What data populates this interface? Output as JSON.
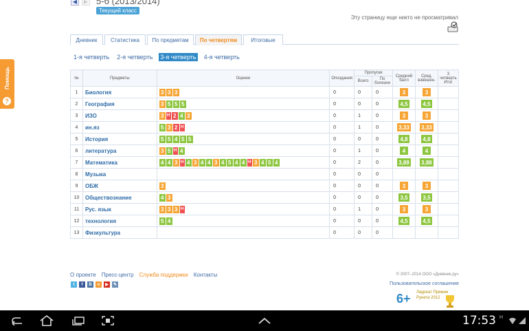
{
  "header": {
    "class_title": "5-б (2013/2014)",
    "current_class_badge": "Текущий класс",
    "no_views_text": "Эту страницу еще никто не просматривал"
  },
  "help_tab": {
    "label": "Помощь",
    "icon": "question-icon"
  },
  "tabs": [
    {
      "label": "Дневник",
      "active": false,
      "w": 48
    },
    {
      "label": "Статистика",
      "active": false,
      "w": 60
    },
    {
      "label": "По предметам",
      "active": false,
      "w": 68
    },
    {
      "label": "По четвертям",
      "active": true,
      "w": 68
    },
    {
      "label": "Итоговые",
      "active": false,
      "w": 58
    }
  ],
  "quarters": [
    {
      "label": "1-я четверть",
      "active": false
    },
    {
      "label": "2-я четверть",
      "active": false
    },
    {
      "label": "3-я четверть",
      "active": true
    },
    {
      "label": "4-я четверть",
      "active": false
    }
  ],
  "table": {
    "headers": {
      "num": "№",
      "subjects": "Предметы",
      "marks": "Оценки",
      "late": "Опоздания",
      "absences": "Пропуски",
      "total": "Всего",
      "sick": "По болезни",
      "avg": "Средний балл",
      "weighted": "Сред. взвешен.",
      "final": "3 четверть Итог"
    },
    "rows": [
      {
        "n": "1",
        "subject": "Биология",
        "marks": [
          "3",
          "3",
          "3"
        ],
        "late": "0",
        "total": "0",
        "sick": "0",
        "avg": "3",
        "weighted": "3",
        "avg_color": "orange"
      },
      {
        "n": "2",
        "subject": "География",
        "marks": [
          "3",
          "5",
          "5",
          "5"
        ],
        "late": "0",
        "total": "0",
        "sick": "0",
        "avg": "4,5",
        "weighted": "4,5",
        "avg_color": "green"
      },
      {
        "n": "3",
        "subject": "ИЗО",
        "marks": [
          "3",
          "Н",
          "2",
          "4",
          "3"
        ],
        "late": "0",
        "total": "1",
        "sick": "0",
        "avg": "3",
        "weighted": "3",
        "avg_color": "orange"
      },
      {
        "n": "4",
        "subject": "ин.яз",
        "marks": [
          "5",
          "3",
          "2",
          "Н"
        ],
        "late": "0",
        "total": "1",
        "sick": "0",
        "avg": "3,33",
        "weighted": "3,33",
        "avg_color": "orange"
      },
      {
        "n": "5",
        "subject": "История",
        "marks": [
          "5",
          "5",
          "4",
          "5",
          "5"
        ],
        "late": "0",
        "total": "0",
        "sick": "0",
        "avg": "4,8",
        "weighted": "4,8",
        "avg_color": "green"
      },
      {
        "n": "6",
        "subject": "литература",
        "marks": [
          "3",
          "5",
          "Н",
          "4"
        ],
        "late": "0",
        "total": "1",
        "sick": "0",
        "avg": "4",
        "weighted": "4",
        "avg_color": "green"
      },
      {
        "n": "7",
        "subject": "Математика",
        "marks": [
          "4",
          "4",
          "3",
          "Н",
          "4",
          "3",
          "4",
          "4",
          "3",
          "4",
          "5",
          "4",
          "4",
          "Н",
          "3",
          "4",
          "5",
          "4"
        ],
        "late": "0",
        "total": "2",
        "sick": "0",
        "avg": "3,88",
        "weighted": "3,88",
        "avg_color": "green"
      },
      {
        "n": "8",
        "subject": "Музыка",
        "marks": [],
        "late": "0",
        "total": "0",
        "sick": "0",
        "avg": "",
        "weighted": "",
        "avg_color": ""
      },
      {
        "n": "9",
        "subject": "ОБЖ",
        "marks": [
          "3"
        ],
        "late": "0",
        "total": "0",
        "sick": "0",
        "avg": "3",
        "weighted": "3",
        "avg_color": "orange"
      },
      {
        "n": "10",
        "subject": "Обществознание",
        "marks": [
          "4",
          "3"
        ],
        "late": "0",
        "total": "0",
        "sick": "0",
        "avg": "3,5",
        "weighted": "3,5",
        "avg_color": "green"
      },
      {
        "n": "11",
        "subject": "Рус. язык",
        "marks": [
          "3",
          "3",
          "3",
          "Н"
        ],
        "late": "0",
        "total": "1",
        "sick": "0",
        "avg": "3",
        "weighted": "3",
        "avg_color": "orange"
      },
      {
        "n": "12",
        "subject": "технология",
        "marks": [
          "5",
          "4"
        ],
        "late": "0",
        "total": "0",
        "sick": "0",
        "avg": "4,5",
        "weighted": "4,5",
        "avg_color": "green"
      },
      {
        "n": "13",
        "subject": "Физкультура",
        "marks": [],
        "late": "0",
        "total": "0",
        "sick": "0",
        "avg": "",
        "weighted": "",
        "avg_color": ""
      }
    ]
  },
  "footer": {
    "links": [
      "О проекте",
      "Пресс-центр",
      "Служба поддержки",
      "Контакты"
    ],
    "copyright": "© 2007–2014 ООО «Дневник.ру»",
    "agreement": "Пользовательское соглашение",
    "age_rating": "6+",
    "laureate_line1": "Лауреат Премии",
    "laureate_line2": "Рунета 2012",
    "social": [
      {
        "name": "twitter-icon",
        "glyph": "t",
        "color": "#4fb2e3"
      },
      {
        "name": "facebook-icon",
        "glyph": "f",
        "color": "#3b5998"
      },
      {
        "name": "vkontakte-icon",
        "glyph": "B",
        "color": "#4c75a3"
      },
      {
        "name": "odnoklassniki-icon",
        "glyph": "o",
        "color": "#f59b32"
      },
      {
        "name": "youtube-icon",
        "glyph": "▶",
        "color": "#d62d20"
      },
      {
        "name": "livejournal-icon",
        "glyph": "✎",
        "color": "#6d8fb5"
      }
    ]
  },
  "status_bar": {
    "clock": "17:53",
    "indicator": "H"
  },
  "colors": {
    "green_mark": "#8cc63e",
    "orange_mark": "#f6a534",
    "red_mark": "#ef5050",
    "accent_blue": "#2f89c7",
    "link_blue": "#3d6aa5"
  }
}
